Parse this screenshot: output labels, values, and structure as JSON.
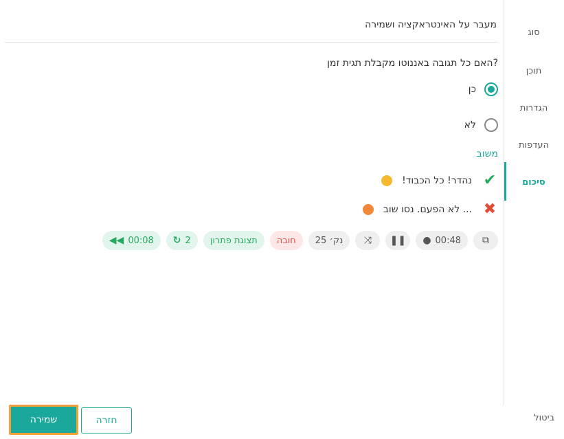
{
  "nav": {
    "items": [
      {
        "label": "סוג",
        "active": false
      },
      {
        "label": "תוכן",
        "active": false
      },
      {
        "label": "הגדרות",
        "active": false
      },
      {
        "label": "העדפות",
        "active": false
      },
      {
        "label": "סיכום",
        "active": true
      }
    ]
  },
  "header": {
    "title": "מעבר על האינטראקציה ושמירה"
  },
  "question": {
    "text": "האם כל תגובה באננוטו מקבלת תגית זמן?"
  },
  "options": [
    {
      "label": "כן",
      "checked": true
    },
    {
      "label": "לא",
      "checked": false
    }
  ],
  "feedback": {
    "title": "משוב",
    "correct": "נהדר! כל הכבוד!",
    "incorrect": "... לא הפעם. נסו שוב"
  },
  "toolbar": {
    "timestamp": "00:48",
    "points": "25 נק׳",
    "required": "חובה",
    "show_solution": "תצוגת פתרון",
    "retries": "2",
    "rewind_time": "00:08"
  },
  "buttons": {
    "save": "שמירה",
    "back": "חזרה",
    "cancel": "ביטול"
  },
  "colors": {
    "accent": "#1aa89a",
    "save_border": "#f2a238",
    "correct": "#27a85f",
    "incorrect": "#e04b3b"
  }
}
